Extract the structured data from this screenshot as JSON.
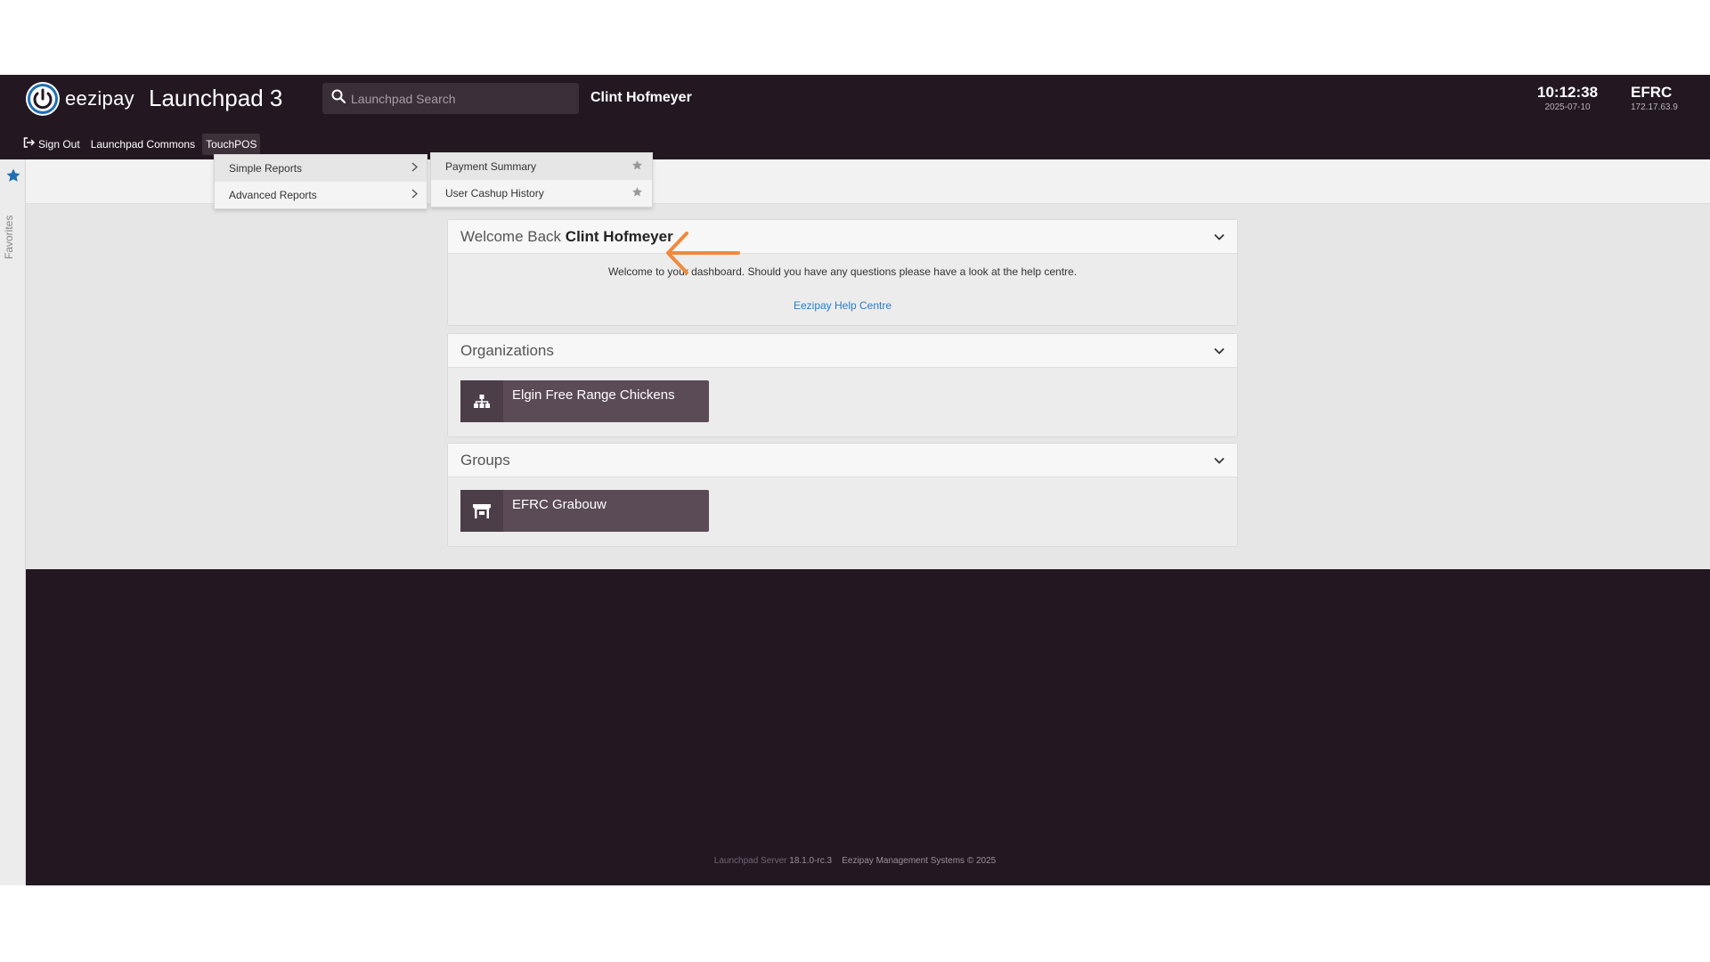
{
  "header": {
    "logo_text": "eezipay",
    "app_title": "Launchpad 3",
    "search_placeholder": "Launchpad Search",
    "user_name": "Clint Hofmeyer",
    "time": "10:12:38",
    "date": "2025-07-10",
    "site_code": "EFRC",
    "site_ip": "172.17.63.9"
  },
  "nav": {
    "sign_out": "Sign Out",
    "commons": "Launchpad Commons",
    "touchpos": "TouchPOS"
  },
  "menu_level1": [
    "Simple Reports",
    "Advanced Reports"
  ],
  "menu_level2": [
    "Payment Summary",
    "User Cashup History"
  ],
  "favorites_label": "Favorites",
  "welcome": {
    "prefix": "Welcome Back",
    "name": "Clint Hofmeyer",
    "text": "Welcome to your dashboard. Should you have any questions please have a look at the help centre.",
    "help_link": "Eezipay Help Centre"
  },
  "organizations": {
    "title": "Organizations",
    "tile": "Elgin Free Range Chickens"
  },
  "groups": {
    "title": "Groups",
    "tile": "EFRC Grabouw"
  },
  "footer": {
    "server_label": "Launchpad Server",
    "version": "18.1.0-rc.3",
    "copyright": "Eezipay Management Systems © 2025"
  },
  "colors": {
    "header_bg": "#231822",
    "tile_bg": "#5a4b57",
    "link": "#2a7cc7",
    "arrow": "#f08a3c"
  }
}
